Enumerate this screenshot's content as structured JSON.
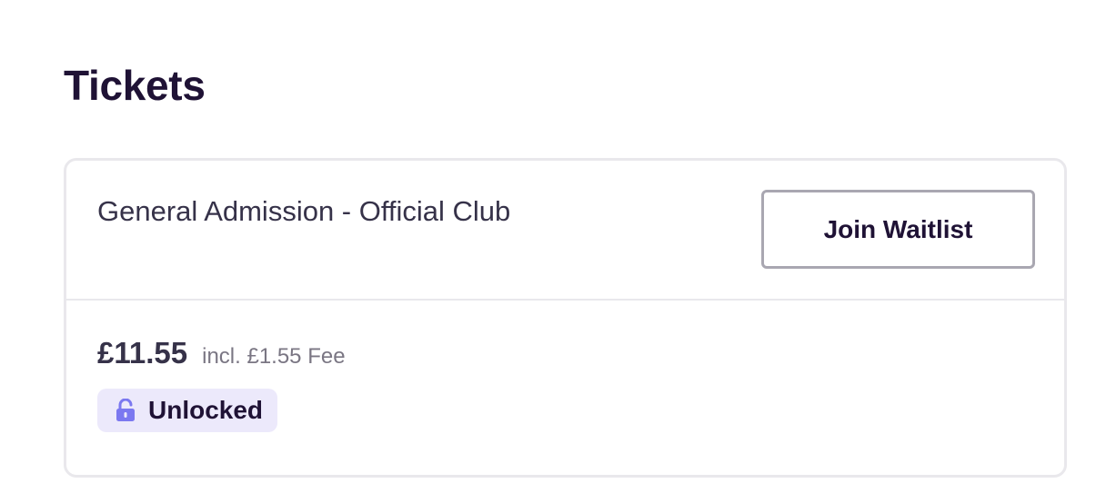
{
  "section": {
    "title": "Tickets"
  },
  "ticket": {
    "name": "General Admission - Official Club",
    "action_label": "Join Waitlist",
    "price": "£11.55",
    "fee_text": "incl. £1.55 Fee",
    "status": {
      "label": "Unlocked",
      "icon": "unlock-icon"
    }
  },
  "colors": {
    "text_primary": "#1f1235",
    "badge_background": "#ece9fb",
    "lock_icon": "#7b78f0",
    "card_border": "#e9e8ec"
  }
}
